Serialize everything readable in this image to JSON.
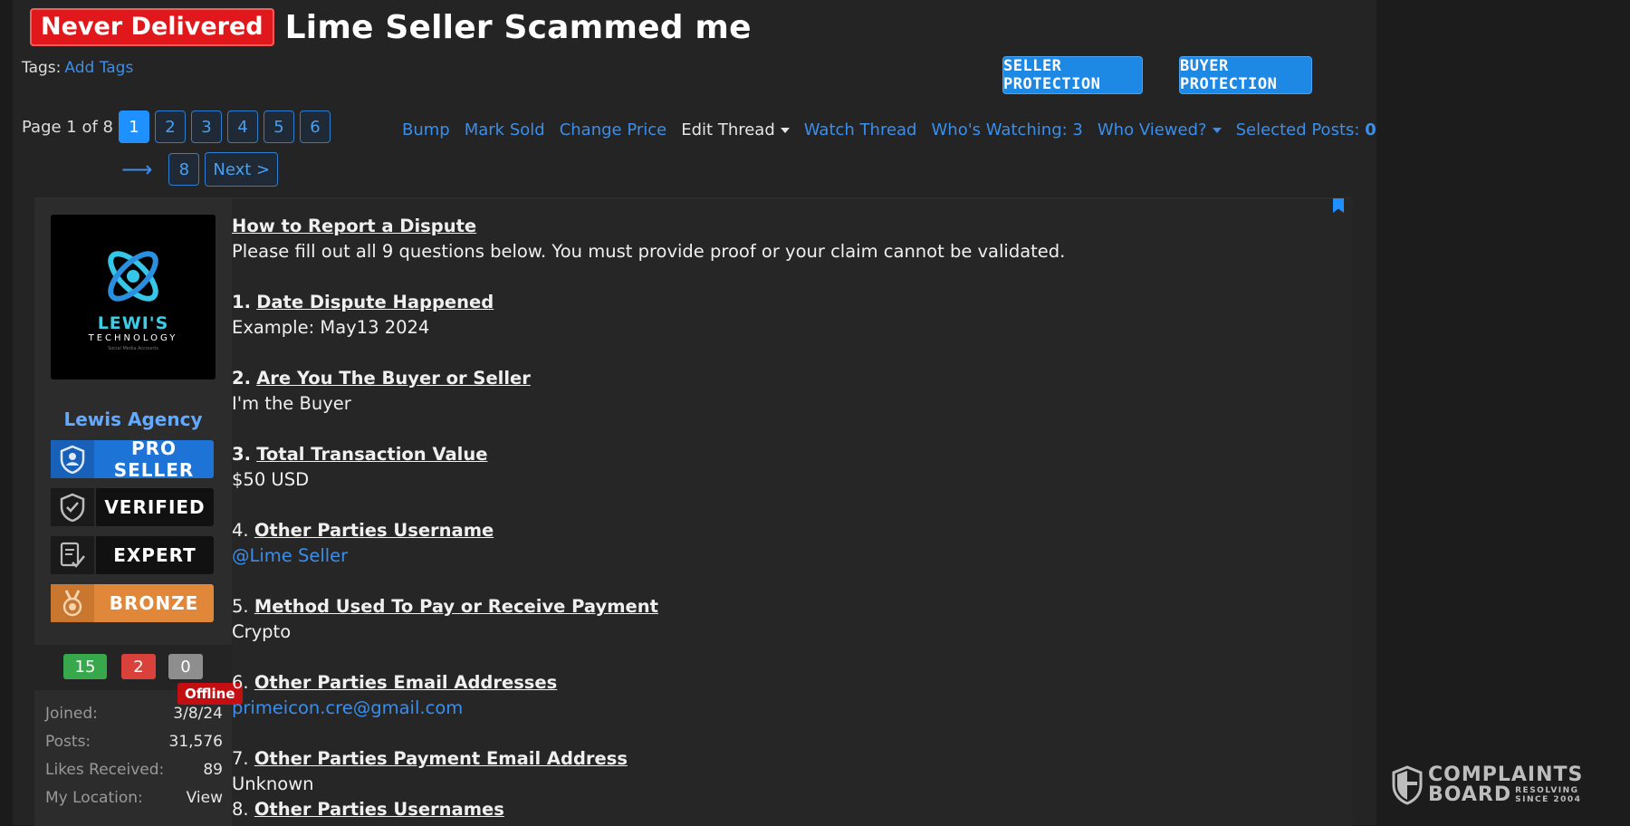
{
  "thread": {
    "prefix": "Never Delivered",
    "title": "Lime Seller Scammed me",
    "tags_label": "Tags:",
    "add_tags": "Add Tags",
    "seller_protection": "SELLER PROTECTION",
    "buyer_protection": "BUYER PROTECTION"
  },
  "pagination": {
    "label": "Page 1 of 8",
    "pages": [
      "1",
      "2",
      "3",
      "4",
      "5",
      "6"
    ],
    "last": "8",
    "next": "Next >"
  },
  "tools": {
    "bump": "Bump",
    "mark_sold": "Mark Sold",
    "change_price": "Change Price",
    "edit_thread": "Edit Thread",
    "watch_thread": "Watch Thread",
    "whos_watching": "Who's Watching: 3",
    "who_viewed": "Who Viewed?",
    "selected_posts_label": "Selected Posts:",
    "selected_posts_count": "0"
  },
  "user": {
    "logo_name": "LEWI'S",
    "logo_sub": "TECHNOLOGY",
    "logo_tiny": "Social Media Accounts",
    "name": "Lewis Agency",
    "badges": [
      "PRO SELLER",
      "VERIFIED",
      "EXPERT",
      "BRONZE"
    ],
    "reactions": [
      "15",
      "2",
      "0"
    ],
    "status": "Offline",
    "info": [
      {
        "k": "Joined:",
        "v": "3/8/24"
      },
      {
        "k": "Posts:",
        "v": "31,576"
      },
      {
        "k": "Likes Received:",
        "v": "89"
      },
      {
        "k": "My Location:",
        "v": "View"
      }
    ]
  },
  "post": {
    "heading": "How to Report a Dispute",
    "intro": "Please fill out all 9 questions below. You must provide proof or your claim cannot be validated.",
    "q1_num": "1.",
    "q1": "Date Dispute Happened",
    "a1": "Example: May13 2024",
    "q2_num": "2.",
    "q2": "Are You The Buyer or Seller",
    "a2": "I'm the Buyer",
    "q3_num": "3.",
    "q3": "Total Transaction Value",
    "a3": "$50 USD",
    "q4_num": "4.",
    "q4": "Other Parties Username",
    "a4": "@Lime Seller",
    "q5_num": "5.",
    "q5": "Method Used To Pay or Receive Payment",
    "a5": "Crypto",
    "q6_num": "6.",
    "q6": "Other Parties Email Addresses",
    "a6": "primeicon.cre@gmail.com",
    "q7_num": "7.",
    "q7": "Other Parties Payment Email Address",
    "a7": "Unknown",
    "q8_num": "8.",
    "q8": "Other Parties Usernames"
  },
  "watermark": {
    "line1": "COMPLAINTS",
    "line2": "BOARD",
    "side1": "RESOLVING",
    "side2": "SINCE 2004"
  },
  "colors": {
    "accent": "#1e90ff",
    "link": "#3b8eea",
    "prefix_red": "#e0181b",
    "bronze": "#e0873a"
  }
}
